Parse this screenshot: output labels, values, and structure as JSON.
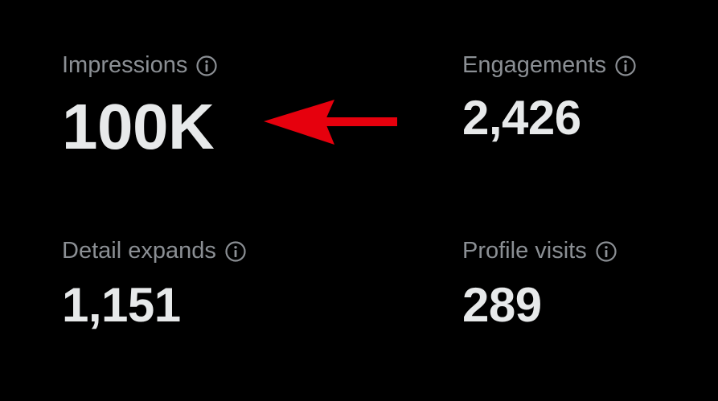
{
  "colors": {
    "background": "#000000",
    "label": "#8b8f94",
    "value": "#e7e9ea",
    "annotation_arrow": "#e6000d"
  },
  "metrics": [
    {
      "label": "Impressions",
      "value": "100K",
      "icon": "info-icon"
    },
    {
      "label": "Engagements",
      "value": "2,426",
      "icon": "info-icon"
    },
    {
      "label": "Detail expands",
      "value": "1,151",
      "icon": "info-icon"
    },
    {
      "label": "Profile visits",
      "value": "289",
      "icon": "info-icon"
    }
  ],
  "annotation": {
    "icon": "arrow-left-icon",
    "points_to": "Impressions"
  }
}
